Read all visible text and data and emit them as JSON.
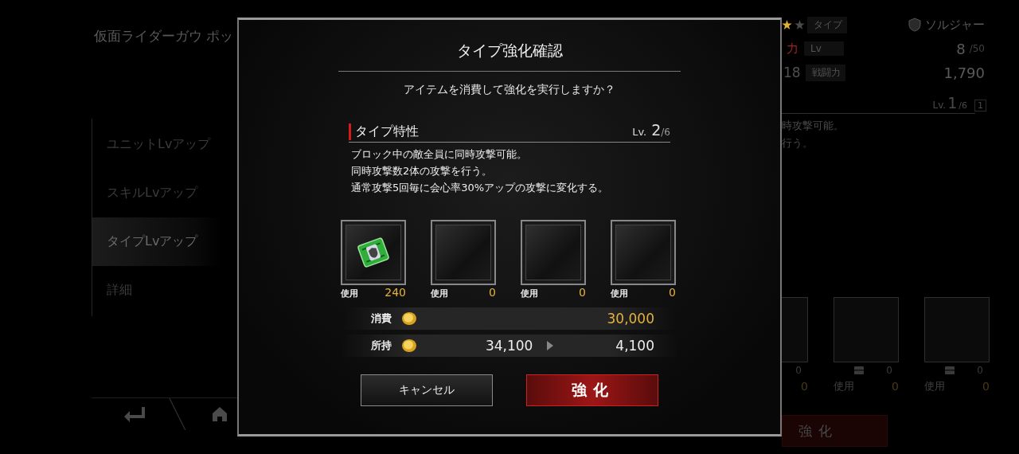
{
  "background": {
    "unit_title": "仮面ライダーガウ ポッ",
    "menu": [
      {
        "label": "ユニットLvアップ",
        "selected": false
      },
      {
        "label": "スキルLvアップ",
        "selected": false
      },
      {
        "label": "タイプLvアップ",
        "selected": true
      },
      {
        "label": "詳細",
        "selected": false
      }
    ],
    "stats": {
      "type_label": "タイプ",
      "type_value": "ソルジャー",
      "attr_mark": "力",
      "level_label": "Lv",
      "level": "8",
      "level_max": "/50",
      "number": "18",
      "power_label": "戦闘力",
      "power": "1,790",
      "type_level_prefix": "Lv.",
      "type_level": "1",
      "type_level_max": "/6",
      "type_level_badge": "1"
    },
    "description": [
      "時攻撃可能。",
      "行う。"
    ],
    "slots": [
      {
        "owned": "0",
        "use_count": "0"
      },
      {
        "owned": "0",
        "use_label": "使用",
        "use_count": "0"
      },
      {
        "owned": "0",
        "use_label": "使用",
        "use_count": "0"
      }
    ],
    "button": "強化"
  },
  "dialog": {
    "title": "タイプ強化確認",
    "question": "アイテムを消費して強化を実行しますか？",
    "section": {
      "title": "タイプ特性",
      "level_prefix": "Lv.",
      "level": "2",
      "level_max": "/6"
    },
    "description": [
      "ブロック中の敵全員に同時攻撃可能。",
      "同時攻撃数2体の攻撃を行う。",
      "通常攻撃5回毎に会心率30%アップの攻撃に変化する。"
    ],
    "materials": [
      {
        "kind": "item",
        "use_label": "使用",
        "count": "240"
      },
      {
        "kind": "empty",
        "use_label": "使用",
        "count": "0"
      },
      {
        "kind": "empty",
        "use_label": "使用",
        "count": "0"
      },
      {
        "kind": "empty",
        "use_label": "使用",
        "count": "0"
      }
    ],
    "costs": [
      {
        "kind": "cost",
        "label": "消費",
        "amount": "30,000"
      },
      {
        "kind": "balance",
        "label": "所持",
        "from": "34,100",
        "amount": "4,100"
      }
    ],
    "buttons": [
      {
        "kind": "cancel",
        "label": "キャンセル"
      },
      {
        "kind": "confirm",
        "label": "強化"
      }
    ]
  }
}
